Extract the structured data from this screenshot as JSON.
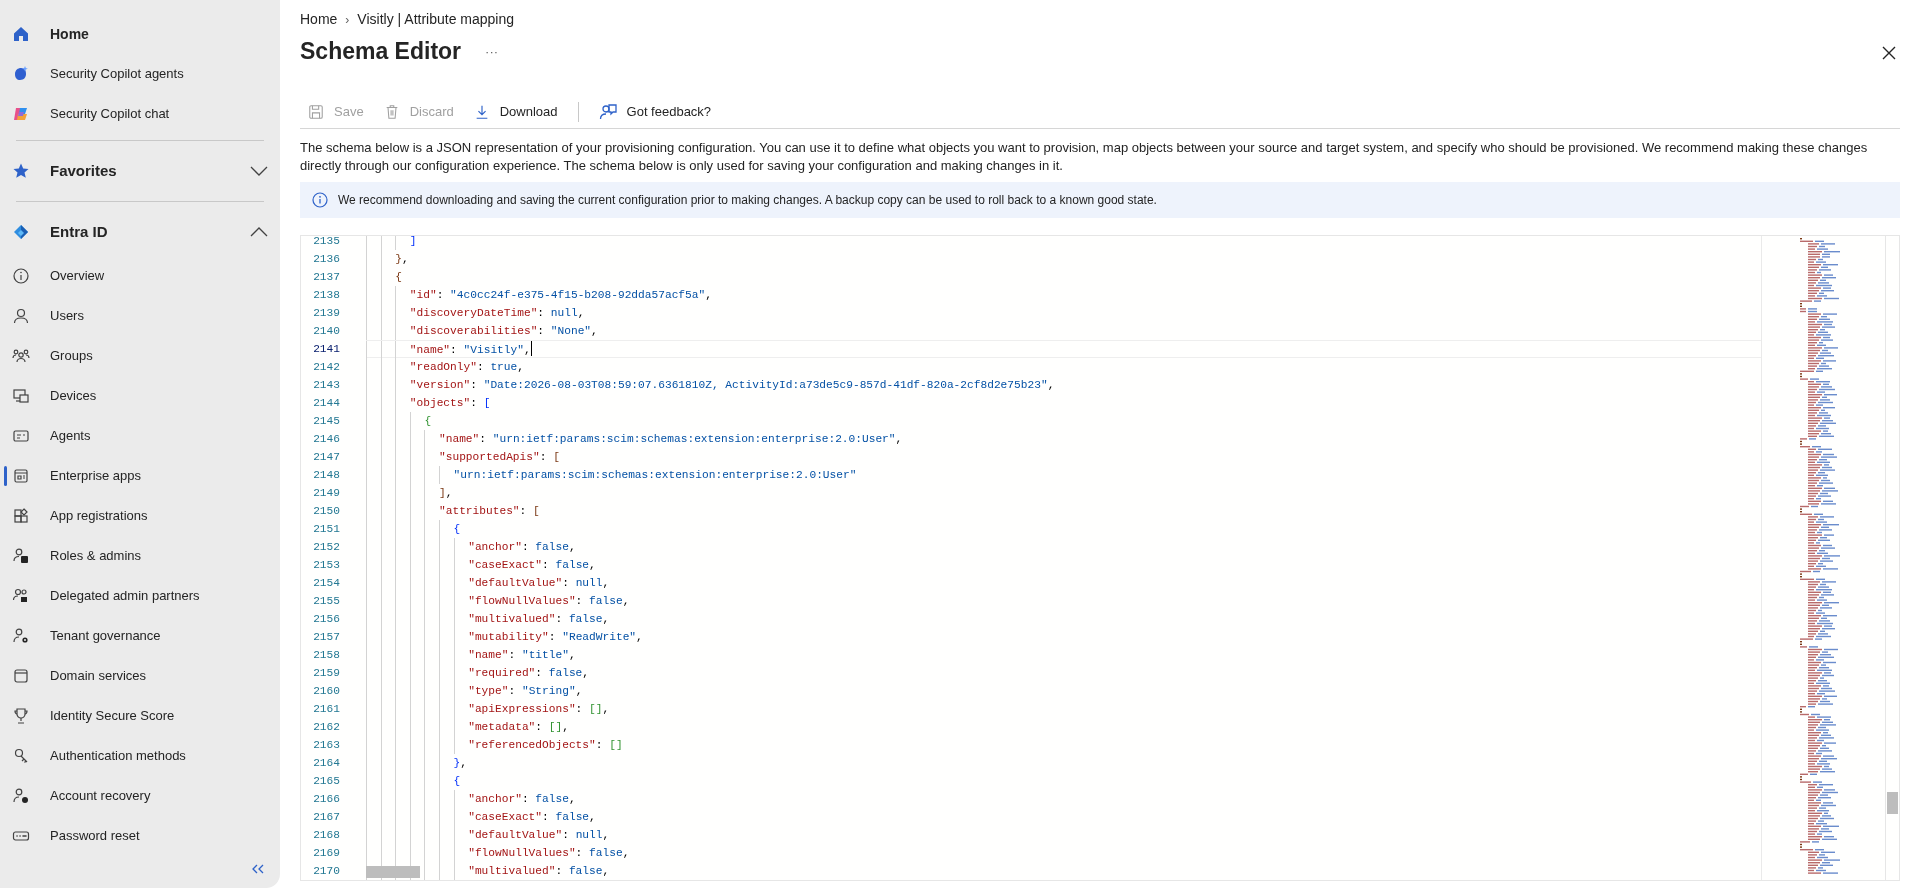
{
  "sidebar": {
    "items": [
      {
        "label": "Home",
        "selected": false
      },
      {
        "label": "Security Copilot agents",
        "selected": false
      },
      {
        "label": "Security Copilot chat",
        "selected": false
      }
    ],
    "groups": [
      {
        "label": "Favorites",
        "expanded": false
      },
      {
        "label": "Entra ID",
        "expanded": true,
        "children": [
          {
            "label": "Overview",
            "selected": false
          },
          {
            "label": "Users",
            "selected": false
          },
          {
            "label": "Groups",
            "selected": false
          },
          {
            "label": "Devices",
            "selected": false
          },
          {
            "label": "Agents",
            "selected": false
          },
          {
            "label": "Enterprise apps",
            "selected": true
          },
          {
            "label": "App registrations",
            "selected": false
          },
          {
            "label": "Roles & admins",
            "selected": false
          },
          {
            "label": "Delegated admin partners",
            "selected": false
          },
          {
            "label": "Tenant governance",
            "selected": false
          },
          {
            "label": "Domain services",
            "selected": false
          },
          {
            "label": "Identity Secure Score",
            "selected": false
          },
          {
            "label": "Authentication methods",
            "selected": false
          },
          {
            "label": "Account recovery",
            "selected": false
          },
          {
            "label": "Password reset",
            "selected": false
          }
        ]
      }
    ]
  },
  "breadcrumb": [
    "Home",
    "Visitly | Attribute mapping"
  ],
  "breadcrumb_separator": "›",
  "title": "Schema Editor",
  "more": "···",
  "toolbar": [
    {
      "label": "Save",
      "disabled": true
    },
    {
      "label": "Discard",
      "disabled": true
    },
    {
      "label": "Download",
      "disabled": false
    },
    {
      "label": "Got feedback?",
      "disabled": false
    }
  ],
  "description": "The schema below is a JSON representation of your provisioning configuration. You can use it to define what objects you want to provision, map objects between your source and target system, and specify who should be provisioned. We recommend making these changes directly through our configuration experience. The schema below is only used for saving your configuration and making changes in it.",
  "info": "We recommend downloading and saving the current configuration prior to making changes. A backup copy can be used to roll back to a known good state.",
  "editor": {
    "lines": [
      {
        "number": "2135",
        "text": "      ]",
        "current": false
      },
      {
        "number": "2136",
        "text": "    },",
        "current": false
      },
      {
        "number": "2137",
        "text": "    {",
        "current": false
      },
      {
        "number": "2138",
        "text": "      \"id\": \"4c0cc24f-e375-4f15-b208-92dda57acf5a\",",
        "current": false
      },
      {
        "number": "2139",
        "text": "      \"discoveryDateTime\": null,",
        "current": false
      },
      {
        "number": "2140",
        "text": "      \"discoverabilities\": \"None\",",
        "current": false
      },
      {
        "number": "2141",
        "text": "      \"name\": \"Visitly\",",
        "current": true
      },
      {
        "number": "2142",
        "text": "      \"readOnly\": true,",
        "current": false
      },
      {
        "number": "2143",
        "text": "      \"version\": \"Date:2026-08-03T08:59:07.6361810Z, ActivityId:a73de5c9-857d-41df-820a-2cf8d2e75b23\",",
        "current": false
      },
      {
        "number": "2144",
        "text": "      \"objects\": [",
        "current": false
      },
      {
        "number": "2145",
        "text": "        {",
        "current": false
      },
      {
        "number": "2146",
        "text": "          \"name\": \"urn:ietf:params:scim:schemas:extension:enterprise:2.0:User\",",
        "current": false
      },
      {
        "number": "2147",
        "text": "          \"supportedApis\": [",
        "current": false
      },
      {
        "number": "2148",
        "text": "            \"urn:ietf:params:scim:schemas:extension:enterprise:2.0:User\"",
        "current": false
      },
      {
        "number": "2149",
        "text": "          ],",
        "current": false
      },
      {
        "number": "2150",
        "text": "          \"attributes\": [",
        "current": false
      },
      {
        "number": "2151",
        "text": "            {",
        "current": false
      },
      {
        "number": "2152",
        "text": "              \"anchor\": false,",
        "current": false
      },
      {
        "number": "2153",
        "text": "              \"caseExact\": false,",
        "current": false
      },
      {
        "number": "2154",
        "text": "              \"defaultValue\": null,",
        "current": false
      },
      {
        "number": "2155",
        "text": "              \"flowNullValues\": false,",
        "current": false
      },
      {
        "number": "2156",
        "text": "              \"multivalued\": false,",
        "current": false
      },
      {
        "number": "2157",
        "text": "              \"mutability\": \"ReadWrite\",",
        "current": false
      },
      {
        "number": "2158",
        "text": "              \"name\": \"title\",",
        "current": false
      },
      {
        "number": "2159",
        "text": "              \"required\": false,",
        "current": false
      },
      {
        "number": "2160",
        "text": "              \"type\": \"String\",",
        "current": false
      },
      {
        "number": "2161",
        "text": "              \"apiExpressions\": [],",
        "current": false
      },
      {
        "number": "2162",
        "text": "              \"metadata\": [],",
        "current": false
      },
      {
        "number": "2163",
        "text": "              \"referencedObjects\": []",
        "current": false
      },
      {
        "number": "2164",
        "text": "            },",
        "current": false
      },
      {
        "number": "2165",
        "text": "            {",
        "current": false
      },
      {
        "number": "2166",
        "text": "              \"anchor\": false,",
        "current": false
      },
      {
        "number": "2167",
        "text": "              \"caseExact\": false,",
        "current": false
      },
      {
        "number": "2168",
        "text": "              \"defaultValue\": null,",
        "current": false
      },
      {
        "number": "2169",
        "text": "              \"flowNullValues\": false,",
        "current": false
      },
      {
        "number": "2170",
        "text": "              \"multivalued\": false,",
        "current": false
      }
    ]
  }
}
